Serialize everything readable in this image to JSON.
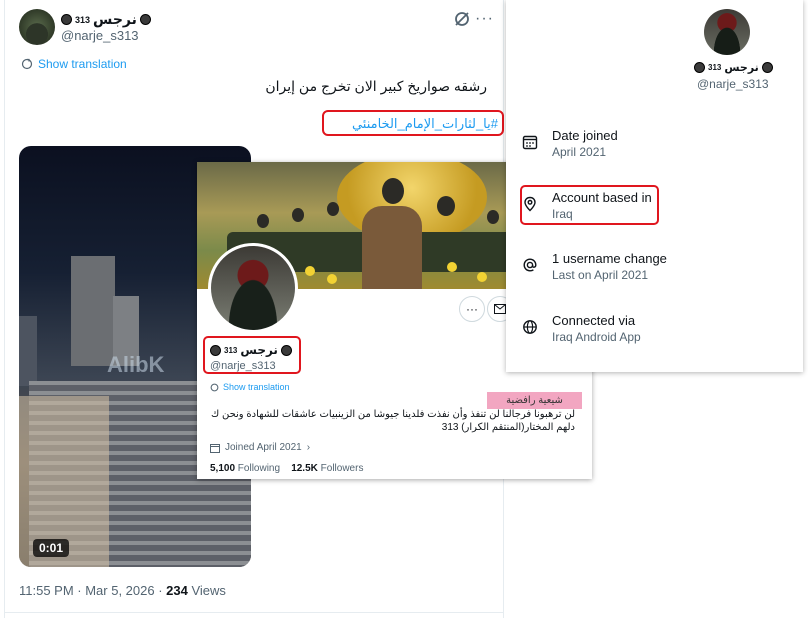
{
  "tweet": {
    "display_name": "نرجس",
    "name_sup": "313",
    "handle": "@narje_s313",
    "show_translation": "Show translation",
    "text": "رشقه صواريخ كبير الان تخرج من إيران",
    "hashtag": "#يا_لثارات_الإمام_الخامنئي",
    "video_time": "0:01",
    "watermark": "AlibK",
    "timestamp": "11:55 PM · Mar 5, 2026 · ",
    "views_count": "234",
    "views_label": " Views"
  },
  "profile": {
    "display_name": "نرجس",
    "name_sup": "313",
    "handle": "@narje_s313",
    "show_translation": "Show translation",
    "pink_label": "شيعية رافضية",
    "bio": "لن ترهبونا فرجالنا لن تنفذ وأن نفذت فلدينا جيوشا من الزينبيات عاشقات للشهادة ونحن ك دلهم المختار(المنتقم الكرار) 313",
    "joined": "Joined April 2021",
    "following_count": "5,100",
    "following_label": " Following",
    "followers_count": "12.5K",
    "followers_label": " Followers"
  },
  "about": {
    "display_name": "نرجس",
    "name_sup": "313",
    "handle": "@narje_s313",
    "rows": [
      {
        "title": "Date joined",
        "sub": "April 2021",
        "icon": "calendar-icon"
      },
      {
        "title": "Account based in",
        "sub": "Iraq",
        "icon": "location-pin-icon"
      },
      {
        "title": "1 username change",
        "sub": "Last on April 2021",
        "icon": "at-sign-icon"
      },
      {
        "title": "Connected via",
        "sub": "Iraq Android App",
        "icon": "globe-icon"
      }
    ]
  },
  "colors": {
    "accent": "#1d9bf0",
    "highlight": "#e0161e",
    "pink": "#f2a6c1"
  }
}
